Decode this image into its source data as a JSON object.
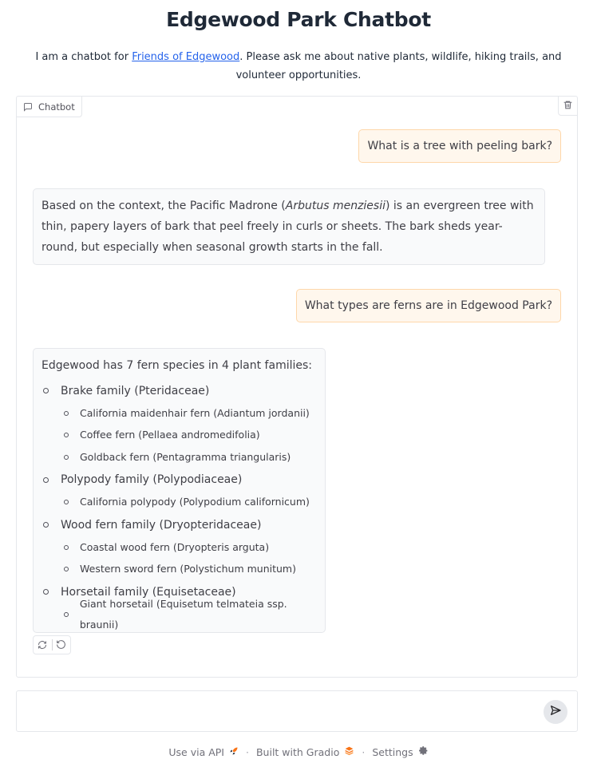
{
  "header": {
    "title": "Edgewood Park Chatbot",
    "desc_before": "I am a chatbot for ",
    "desc_link": "Friends of Edgewood",
    "desc_after": ". Please ask me about native plants, wildlife, hiking trails, and volunteer opportunities."
  },
  "chatbot": {
    "label": "Chatbot",
    "icons": {
      "label": "chat-icon",
      "clear": "trash-icon"
    }
  },
  "messages": {
    "q1": "What is a tree with peeling bark?",
    "a1_before": "Based on the context, the Pacific Madrone (",
    "a1_italic": "Arbutus menziesii",
    "a1_after": ") is an evergreen tree with thin, papery layers of bark that peel freely in curls or sheets. The bark sheds year-round, but especially when seasonal growth starts in the fall.",
    "q2": "What types are ferns are in Edgewood Park?",
    "a2_intro": "Edgewood has 7 fern species in 4 plant families:",
    "families": [
      {
        "name": "Brake family (Pteridaceae)",
        "species": [
          "California maidenhair fern (Adiantum jordanii)",
          "Coffee fern (Pellaea andromedifolia)",
          "Goldback fern (Pentagramma triangularis)"
        ]
      },
      {
        "name": "Polypody family (Polypodiaceae)",
        "species": [
          "California polypody (Polypodium californicum)"
        ]
      },
      {
        "name": "Wood fern family (Dryopteridaceae)",
        "species": [
          "Coastal wood fern (Dryopteris arguta)",
          "Western sword fern (Polystichum munitum)"
        ]
      },
      {
        "name": "Horsetail family (Equisetaceae)",
        "species": [
          "Giant horsetail (Equisetum telmateia ssp. braunii)"
        ]
      }
    ]
  },
  "actions": {
    "retry": "retry-icon",
    "undo": "undo-icon"
  },
  "input": {
    "value": "",
    "placeholder": "",
    "send": "send-icon"
  },
  "footer": {
    "api": "Use via API",
    "built": "Built with Gradio",
    "settings": "Settings",
    "separator": "·"
  },
  "colors": {
    "user_bubble": "#fff7ed",
    "user_border": "#fed7aa",
    "bot_bubble": "#f9fafb",
    "link": "#2563eb",
    "gradio_orange": "#f97316"
  }
}
